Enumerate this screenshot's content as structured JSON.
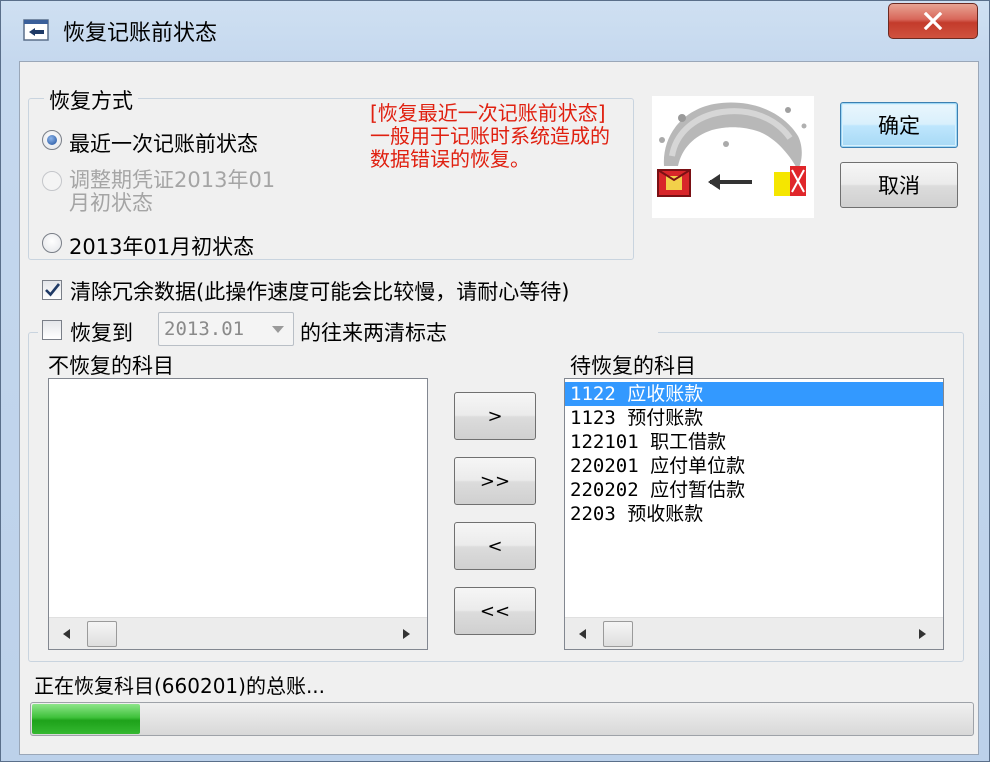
{
  "window": {
    "title": "恢复记账前状态",
    "app_icon": "dialog-icon",
    "close_icon": "close-icon",
    "colors": {
      "titlebar": "#c5d8ee",
      "close": "#c33b2b",
      "selection": "#3399ff",
      "note": "#e02010",
      "progress": "#3fc13b"
    }
  },
  "restore_mode": {
    "legend": "恢复方式",
    "options": [
      {
        "label": "最近一次记账前状态",
        "checked": true,
        "enabled": true
      },
      {
        "label": "调整期凭证2013年01\n月初状态",
        "checked": false,
        "enabled": false
      },
      {
        "label": "2013年01月初状态",
        "checked": false,
        "enabled": true
      }
    ],
    "note": "[恢复最近一次记账前状态]一般用于记账时系统造成的数据错误的恢复。"
  },
  "buttons": {
    "ok": "确定",
    "cancel": "取消"
  },
  "clear_redundant": {
    "checked": true,
    "label": "清除冗余数据(此操作速度可能会比较慢，请耐心等待)"
  },
  "restore_to": {
    "checked": false,
    "label": "恢复到",
    "period_value": "2013.01",
    "suffix": "的往来两清标志"
  },
  "lists": {
    "left_title": "不恢复的科目",
    "left_items": [],
    "right_title": "待恢复的科目",
    "right_items": [
      {
        "text": "1122 应收账款",
        "selected": true
      },
      {
        "text": "1123 预付账款",
        "selected": false
      },
      {
        "text": "122101 职工借款",
        "selected": false
      },
      {
        "text": "220201 应付单位款",
        "selected": false
      },
      {
        "text": "220202 应付暂估款",
        "selected": false
      },
      {
        "text": "2203 预收账款",
        "selected": false
      }
    ]
  },
  "transfer_buttons": [
    ">",
    ">>",
    "<",
    "<<"
  ],
  "status": {
    "text": "正在恢复科目(660201)的总账...",
    "progress": 0.115
  }
}
